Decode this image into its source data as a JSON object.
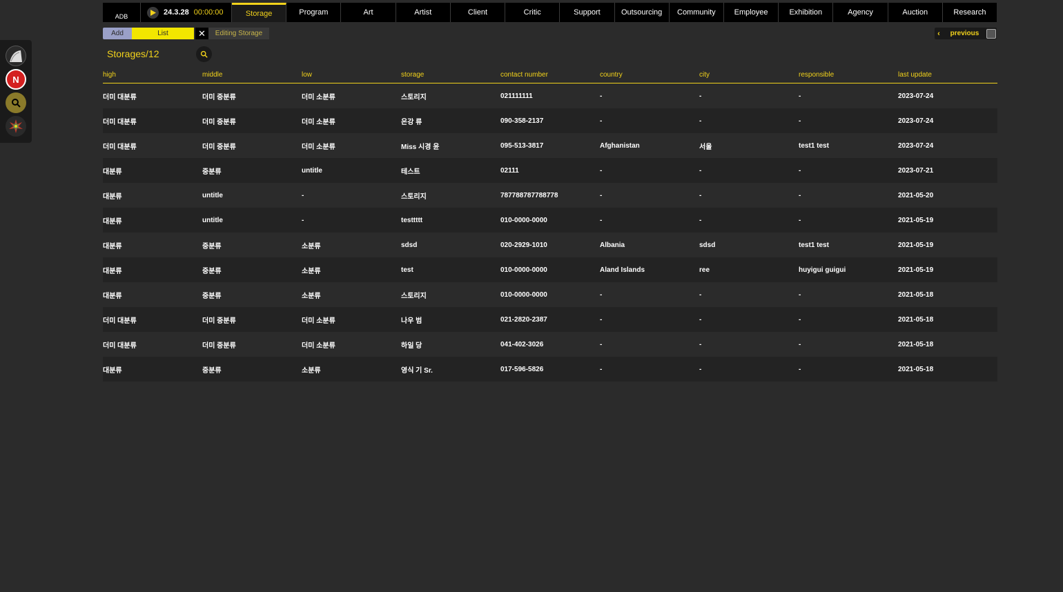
{
  "brand": {
    "label": "ADB"
  },
  "clock": {
    "date": "24.3.28",
    "time": "00:00:00"
  },
  "nav": {
    "tabs": [
      {
        "label": "Storage",
        "active": true
      },
      {
        "label": "Program"
      },
      {
        "label": "Art"
      },
      {
        "label": "Artist"
      },
      {
        "label": "Client"
      },
      {
        "label": "Critic"
      },
      {
        "label": "Support"
      },
      {
        "label": "Outsourcing"
      },
      {
        "label": "Community"
      },
      {
        "label": "Employee"
      },
      {
        "label": "Exhibition"
      },
      {
        "label": "Agency"
      },
      {
        "label": "Auction"
      },
      {
        "label": "Research"
      }
    ]
  },
  "rail": {
    "n_badge": "N"
  },
  "toolbar": {
    "add_label": "Add",
    "list_label": "List",
    "close_label": "✕",
    "edit_tab_label": "Editing Storage",
    "previous_label": "previous",
    "previous_chevron": "‹"
  },
  "list": {
    "title": "Storages/12"
  },
  "table": {
    "columns": [
      "high",
      "middle",
      "low",
      "storage",
      "contact number",
      "country",
      "city",
      "responsible",
      "last update"
    ],
    "rows": [
      [
        "더미 대분류",
        "더미 중분류",
        "더미 소분류",
        "스토리지",
        "021111111",
        "-",
        "-",
        "-",
        "2023-07-24"
      ],
      [
        "더미 대분류",
        "더미 중분류",
        "더미 소분류",
        "은강 류",
        "090-358-2137",
        "-",
        "-",
        "-",
        "2023-07-24"
      ],
      [
        "더미 대분류",
        "더미 중분류",
        "더미 소분류",
        "Miss 시경 윤",
        "095-513-3817",
        "Afghanistan",
        "서울",
        "test1 test",
        "2023-07-24"
      ],
      [
        "대분류",
        "중분류",
        "untitle",
        "테스트",
        "02111",
        "-",
        "-",
        "-",
        "2023-07-21"
      ],
      [
        "대분류",
        "untitle",
        "-",
        "스토리지",
        "787788787788778",
        "-",
        "-",
        "-",
        "2021-05-20"
      ],
      [
        "대분류",
        "untitle",
        "-",
        "testtttt",
        "010-0000-0000",
        "-",
        "-",
        "-",
        "2021-05-19"
      ],
      [
        "대분류",
        "중분류",
        "소분류",
        "sdsd",
        "020-2929-1010",
        "Albania",
        "sdsd",
        "test1 test",
        "2021-05-19"
      ],
      [
        "대분류",
        "중분류",
        "소분류",
        "test",
        "010-0000-0000",
        "Aland Islands",
        "ree",
        "huyigui guigui",
        "2021-05-19"
      ],
      [
        "대분류",
        "중분류",
        "소분류",
        "스토리지",
        "010-0000-0000",
        "-",
        "-",
        "-",
        "2021-05-18"
      ],
      [
        "더미 대분류",
        "더미 중분류",
        "더미 소분류",
        "나우 범",
        "021-2820-2387",
        "-",
        "-",
        "-",
        "2021-05-18"
      ],
      [
        "더미 대분류",
        "더미 중분류",
        "더미 소분류",
        "하일 당",
        "041-402-3026",
        "-",
        "-",
        "-",
        "2021-05-18"
      ],
      [
        "대분류",
        "중분류",
        "소분류",
        "영식 기 Sr.",
        "017-596-5826",
        "-",
        "-",
        "-",
        "2021-05-18"
      ]
    ]
  },
  "colors": {
    "accent": "#f2d21b",
    "background": "#2b2b2b",
    "add_button": "#9aa0c8",
    "list_button": "#f2e600"
  }
}
